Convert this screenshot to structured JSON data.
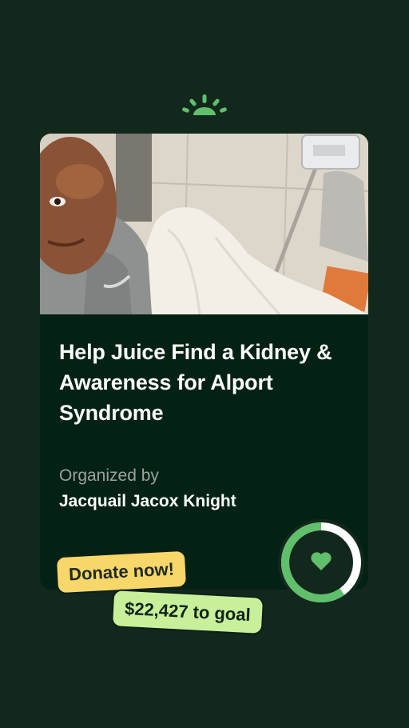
{
  "brand": {
    "logo_icon": "sunrise-logo-icon",
    "accent": "#5fbf6a"
  },
  "campaign": {
    "title": "Help Juice Find a Kidney & Awareness for Alport Syndrome",
    "organized_label": "Organized by",
    "organizer": "Jacquail Jacox Knight",
    "photo_icon": "hospital-selfie-photo"
  },
  "progress": {
    "fraction": 0.6,
    "icon": "heart-icon",
    "ring_color": "#5fbf6a",
    "track_color": "#ffffff"
  },
  "cta": {
    "donate_label": "Donate now!",
    "donate_color": "#f7d66a"
  },
  "goal": {
    "text": "$22,427 to goal",
    "badge_color": "#c8ef9a"
  }
}
